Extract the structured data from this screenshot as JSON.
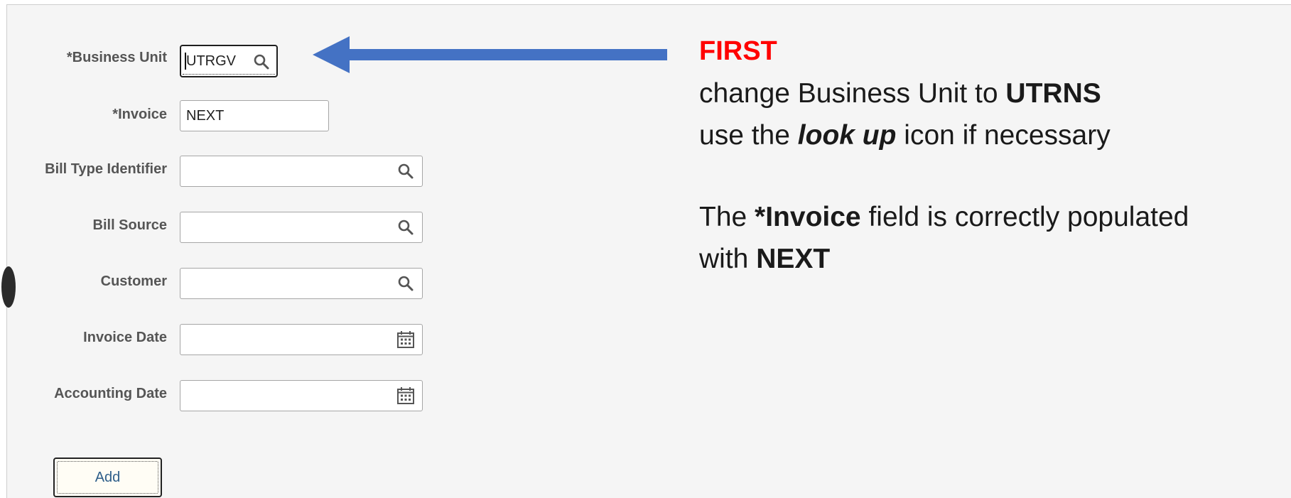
{
  "form": {
    "business_unit": {
      "label": "*Business Unit",
      "value": "UTRGV",
      "icon": "search-icon"
    },
    "invoice": {
      "label": "*Invoice",
      "value": "NEXT"
    },
    "bill_type_identifier": {
      "label": "Bill Type Identifier",
      "value": "",
      "icon": "search-icon"
    },
    "bill_source": {
      "label": "Bill Source",
      "value": "",
      "icon": "search-icon"
    },
    "customer": {
      "label": "Customer",
      "value": "",
      "icon": "search-icon"
    },
    "invoice_date": {
      "label": "Invoice Date",
      "value": "",
      "icon": "calendar-icon"
    },
    "accounting_date": {
      "label": "Accounting Date",
      "value": "",
      "icon": "calendar-icon"
    },
    "add_label": "Add"
  },
  "annotation": {
    "arrow_color": "#4472c4",
    "first": "FIRST",
    "first_color": "#ff0000",
    "line1_text": "change Business Unit to ",
    "line1_bold": "UTRNS",
    "line2_pre": "use the ",
    "line2_emph": "look up",
    "line2_post": " icon if necessary",
    "line3_pre": "The ",
    "line3_bold": "*Invoice",
    "line3_post": " field is correctly populated",
    "line4_pre": "with ",
    "line4_bold": "NEXT"
  }
}
